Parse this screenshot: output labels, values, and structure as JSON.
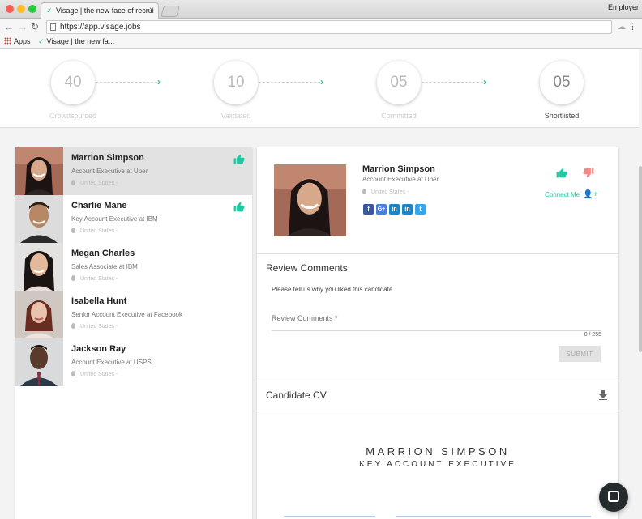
{
  "browser": {
    "tab_title": "Visage | the new face of recrui",
    "tab_close": "×",
    "profile": "Employer",
    "url": "https://app.visage.jobs",
    "bookmarks": [
      "Apps",
      "Visage | the new fa..."
    ]
  },
  "pipeline": {
    "stages": [
      {
        "count": "40",
        "label": "Crowdsourced"
      },
      {
        "count": "10",
        "label": "Validated"
      },
      {
        "count": "05",
        "label": "Committed"
      },
      {
        "count": "05",
        "label": "Shortlisted"
      }
    ],
    "arrow": "›"
  },
  "candidates": [
    {
      "name": "Marrion Simpson",
      "title": "Account Executive at Uber",
      "location": "United States -",
      "liked": true
    },
    {
      "name": "Charlie Mane",
      "title": "Key Account Executive at IBM",
      "location": "United States -",
      "liked": true
    },
    {
      "name": "Megan Charles",
      "title": "Sales Associate at IBM",
      "location": "United States -",
      "liked": false
    },
    {
      "name": "Isabella Hunt",
      "title": "Senior Account Executive at Facebook",
      "location": "United States -",
      "liked": false
    },
    {
      "name": "Jackson Ray",
      "title": "Account Executive at USPS",
      "location": "United States -",
      "liked": false
    }
  ],
  "detail": {
    "name": "Marrion Simpson",
    "title": "Account Executive at Uber",
    "location": "United States -",
    "connect": "Connect Me",
    "socials": [
      "f",
      "G+",
      "in",
      "in",
      "t"
    ]
  },
  "review": {
    "heading": "Review Comments",
    "prompt": "Please tell us why you liked this candidate.",
    "placeholder": "Review Comments *",
    "counter": "0 / 255",
    "submit": "SUBMIT"
  },
  "cv": {
    "heading": "Candidate CV",
    "doc_name": "MARRION SIMPSON",
    "doc_title": "KEY ACCOUNT EXECUTIVE"
  },
  "colors": {
    "accent": "#1fc9a0",
    "dislike": "#f08a8a",
    "facebook": "#3b5998",
    "google": "#4a7fd8",
    "linkedin": "#1b86c6",
    "twitter": "#37a6e8"
  }
}
